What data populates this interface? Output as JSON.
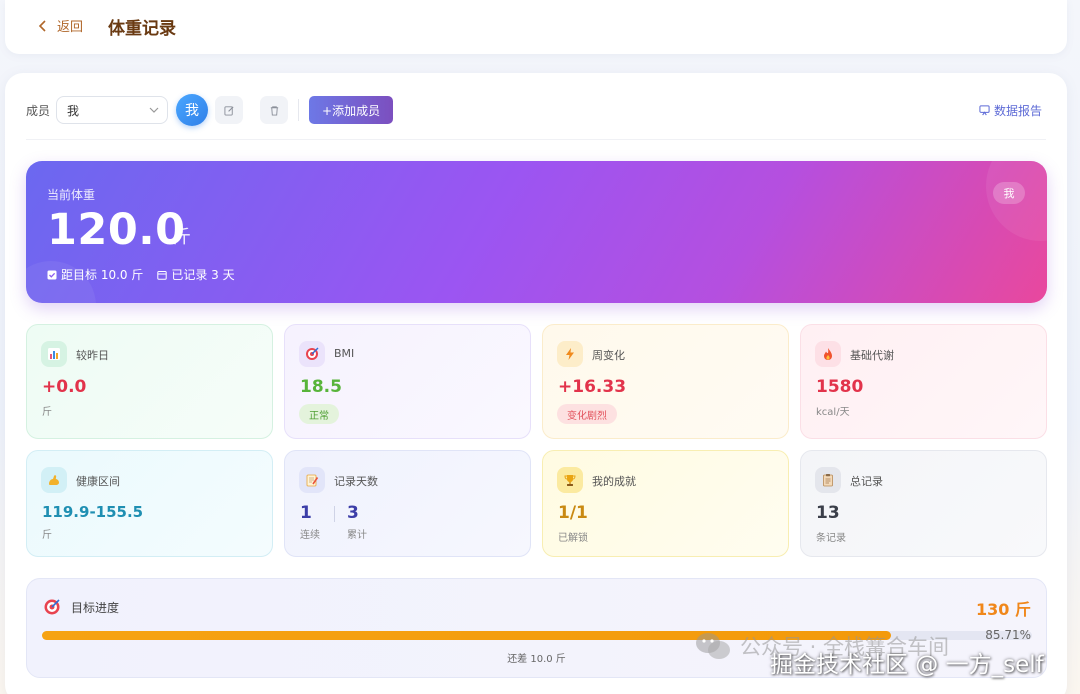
{
  "header": {
    "back_label": "返回",
    "title": "体重记录"
  },
  "toolbar": {
    "member_label": "成员",
    "member_selected": "我",
    "avatar_text": "我",
    "add_member": "+添加成员",
    "report": "数据报告"
  },
  "hero": {
    "label": "当前体重",
    "value": "120.0",
    "unit": "斤",
    "to_goal": "距目标 10.0 斤",
    "recorded": "已记录 3 天",
    "badge": "我",
    "gradient": [
      "#6b68f0",
      "#9b55f2",
      "#e9489d"
    ]
  },
  "stats": {
    "vs_yesterday": {
      "title": "较昨日",
      "value": "+0.0",
      "unit": "斤",
      "color": "#e2334b",
      "icon": "bar-chart-icon"
    },
    "bmi": {
      "title": "BMI",
      "value": "18.5",
      "tag": "正常",
      "color": "#58b43a",
      "icon": "target-icon"
    },
    "weekly": {
      "title": "周变化",
      "value": "+16.33",
      "tag": "变化剧烈",
      "color": "#e2334b",
      "icon": "lightning-icon"
    },
    "bmr": {
      "title": "基础代谢",
      "value": "1580",
      "unit": "kcal/天",
      "color": "#e2334b",
      "icon": "flame-icon"
    },
    "healthy_range": {
      "title": "健康区间",
      "value": "119.9-155.5",
      "unit": "斤",
      "color": "#1f8fb2",
      "icon": "muscle-icon"
    },
    "record_days": {
      "title": "记录天数",
      "streak": "1",
      "streak_label": "连续",
      "total": "3",
      "total_label": "累计",
      "icon": "memo-icon"
    },
    "achievements": {
      "title": "我的成就",
      "value": "1/1",
      "unit": "已解锁",
      "color": "#c98a12",
      "icon": "trophy-icon"
    },
    "total_records": {
      "title": "总记录",
      "value": "13",
      "unit": "条记录",
      "color": "#3b3f4a",
      "icon": "clipboard-icon"
    }
  },
  "goal": {
    "title": "目标进度",
    "target": "130 斤",
    "percent_text": "85.71%",
    "percent": 85.71,
    "remaining": "还差 10.0 斤"
  },
  "watermark": {
    "line1": "公众号 · 全栈篝合车间",
    "line2": "掘金技术社区 @ 一方_self"
  }
}
